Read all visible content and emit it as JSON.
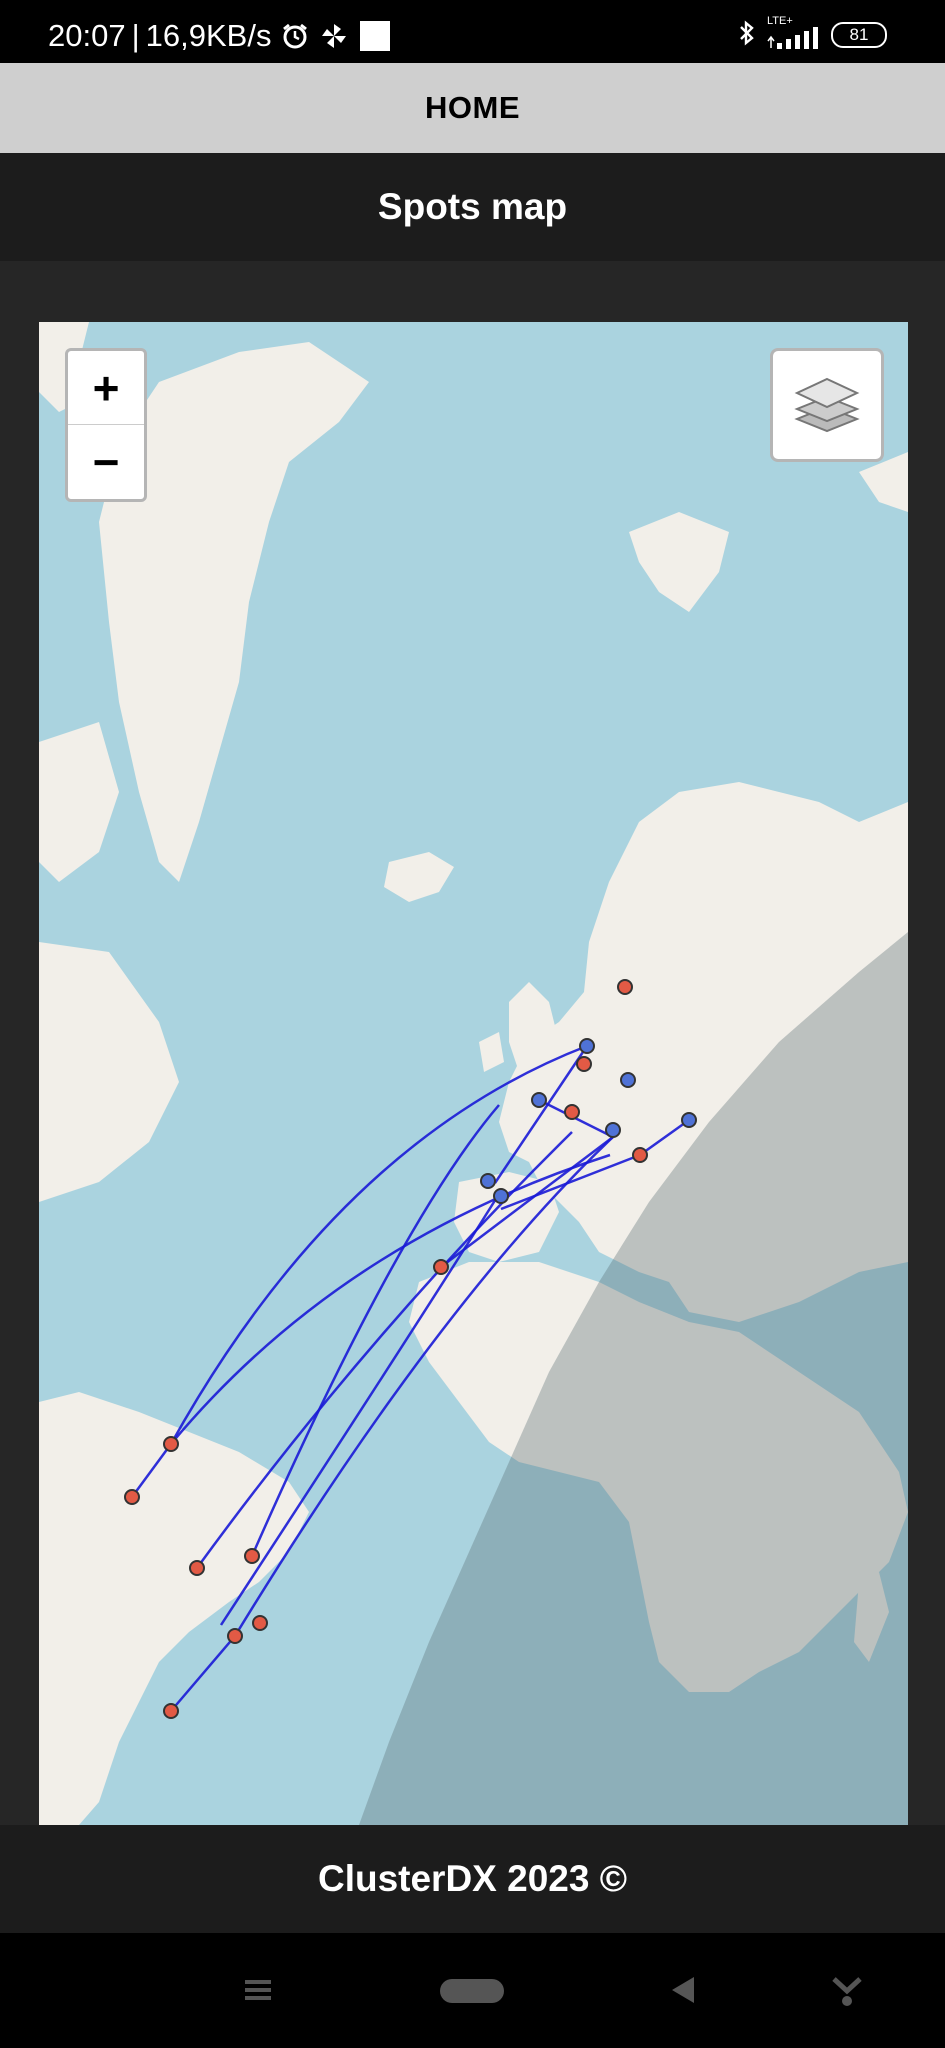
{
  "status_bar": {
    "time": "20:07",
    "separator": "|",
    "speed": "16,9KB/s",
    "network": "LTE+",
    "battery": "81",
    "icons": [
      "alarm-icon",
      "pinwheel-icon",
      "square-icon",
      "bluetooth-icon",
      "signal-icon",
      "battery-icon"
    ]
  },
  "header": {
    "home_label": "HOME"
  },
  "section": {
    "title": "Spots map"
  },
  "map": {
    "controls": {
      "zoom_in": "+",
      "zoom_out": "−",
      "layers_icon": "layers-icon"
    },
    "colors": {
      "water": "#aad3df",
      "land": "#f2efe9",
      "night_overlay": "#5a6c74",
      "spotter_marker": "#4f72d6",
      "dx_marker": "#e25a45",
      "path": "#1a1ad6"
    }
  },
  "footer": {
    "text": "ClusterDX 2023 ©"
  },
  "nav_bar": {
    "icons": [
      "menu-icon",
      "home-pill-icon",
      "back-icon",
      "download-icon"
    ]
  }
}
